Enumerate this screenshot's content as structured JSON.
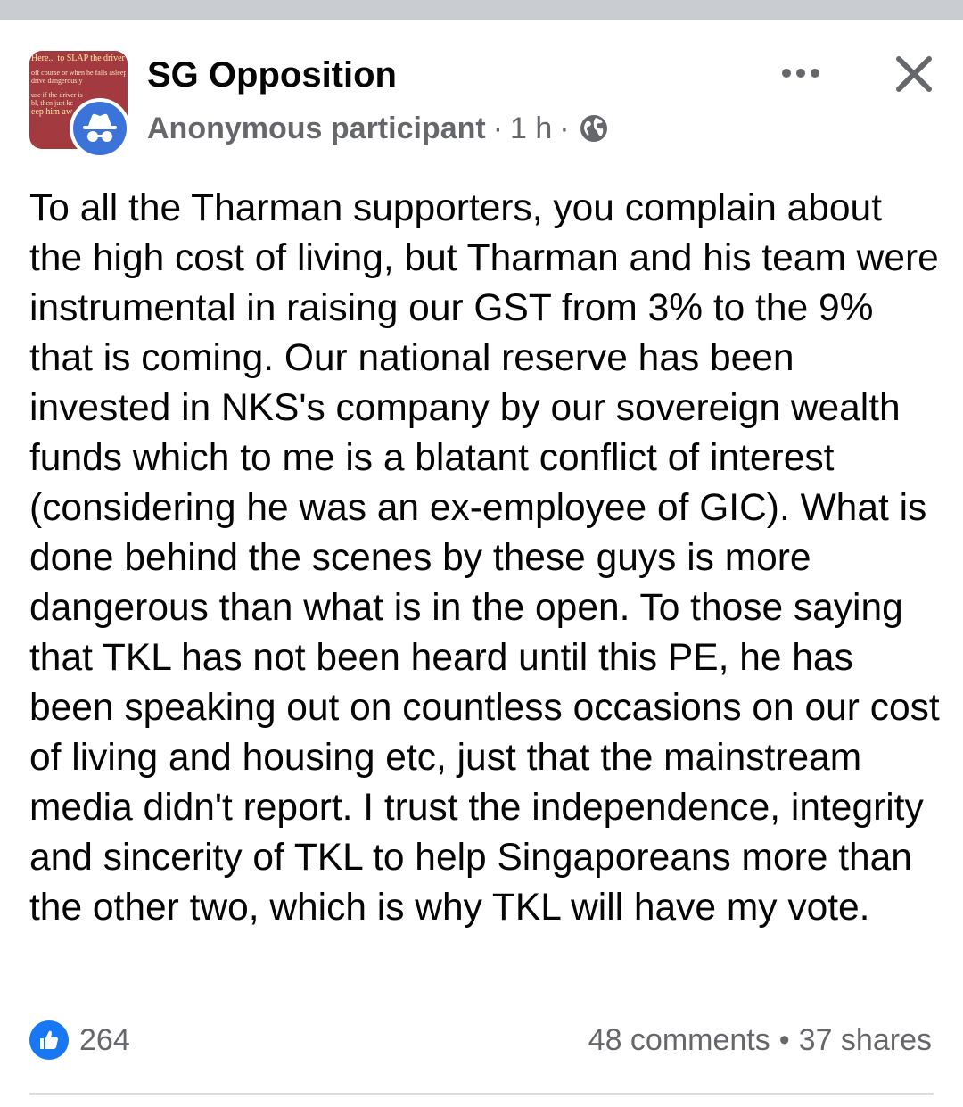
{
  "post": {
    "group_name": "SG Opposition",
    "author": "Anonymous participant",
    "time": "1 h",
    "separator": "·",
    "privacy_icon": "globe-icon",
    "group_thumbnail_text": {
      "line1": "Here... to SLAP the driver",
      "line2": "off course or when he falls asleep",
      "line3": "drive dangerously",
      "line4": "use if the driver is",
      "line5": "bl, then just ke",
      "line6": "eep him aw"
    },
    "text": "To all the Tharman supporters, you complain about the high cost of living, but Tharman and his team were instrumental in raising our GST from 3% to the 9% that is coming. Our national reserve has been invested in NKS's company by our sovereign wealth funds which to me is a blatant conflict of interest (considering he was an ex-employee of GIC). What is done behind the scenes by these guys is more dangerous than what is in the open. To those saying that TKL has not been heard until this PE, he has been speaking out on countless occasions on our cost of living and housing etc, just that the mainstream media didn't report. I trust the independence, integrity and sincerity of TKL to help Singaporeans more than the other two, which is why TKL will have my vote."
  },
  "footer": {
    "likes": "264",
    "comments": "48 comments",
    "dot": "•",
    "shares": "37 shares"
  },
  "colors": {
    "like_blue": "#1877f2",
    "meta_gray": "#65676b",
    "avatar_blue": "#3b73d9",
    "thumb_red": "#a23a3f"
  }
}
